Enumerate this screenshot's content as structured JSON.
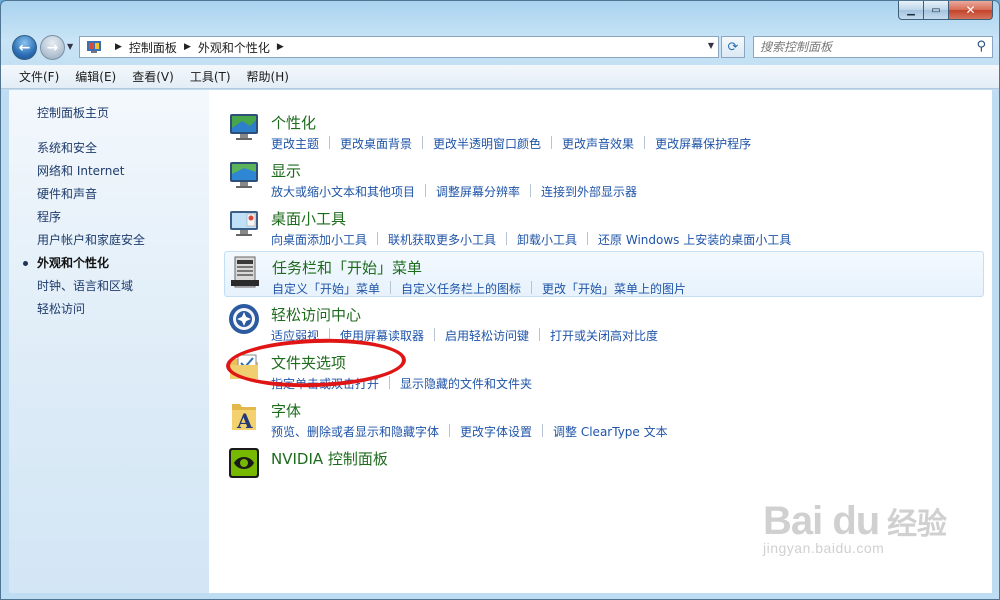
{
  "colors": {
    "link": "#1f54a8",
    "category_title": "#1d6b1d",
    "annotation": "#e01515",
    "sidebar_text": "#1e3b6c"
  },
  "window": {
    "caption_buttons": {
      "minimize_icon": "minimize-icon",
      "maximize_icon": "maximize-icon",
      "close_icon": "close-icon"
    }
  },
  "address": {
    "crumbs": [
      "控制面板",
      "外观和个性化"
    ]
  },
  "search": {
    "placeholder": "搜索控制面板"
  },
  "menu": [
    {
      "label": "文件(F)"
    },
    {
      "label": "编辑(E)"
    },
    {
      "label": "查看(V)"
    },
    {
      "label": "工具(T)"
    },
    {
      "label": "帮助(H)"
    }
  ],
  "sidebar": {
    "home": "控制面板主页",
    "items": [
      {
        "label": "系统和安全",
        "active": false
      },
      {
        "label": "网络和 Internet",
        "active": false
      },
      {
        "label": "硬件和声音",
        "active": false
      },
      {
        "label": "程序",
        "active": false
      },
      {
        "label": "用户帐户和家庭安全",
        "active": false
      },
      {
        "label": "外观和个性化",
        "active": true
      },
      {
        "label": "时钟、语言和区域",
        "active": false
      },
      {
        "label": "轻松访问",
        "active": false
      }
    ]
  },
  "categories": [
    {
      "icon": "monitor-personalize-icon",
      "title": "个性化",
      "links": [
        "更改主题",
        "更改桌面背景",
        "更改半透明窗口颜色",
        "更改声音效果",
        "更改屏幕保护程序"
      ]
    },
    {
      "icon": "display-icon",
      "title": "显示",
      "links": [
        "放大或缩小文本和其他项目",
        "调整屏幕分辨率",
        "连接到外部显示器"
      ]
    },
    {
      "icon": "desktop-gadgets-icon",
      "title": "桌面小工具",
      "links": [
        "向桌面添加小工具",
        "联机获取更多小工具",
        "卸载小工具",
        "还原 Windows 上安装的桌面小工具"
      ]
    },
    {
      "icon": "taskbar-start-menu-icon",
      "title": "任务栏和「开始」菜单",
      "links": [
        "自定义「开始」菜单",
        "自定义任务栏上的图标",
        "更改「开始」菜单上的图片"
      ]
    },
    {
      "icon": "ease-of-access-icon",
      "title": "轻松访问中心",
      "links": [
        "适应弱视",
        "使用屏幕读取器",
        "启用轻松访问键",
        "打开或关闭高对比度"
      ]
    },
    {
      "icon": "folder-options-icon",
      "title": "文件夹选项",
      "links": [
        "指定单击或双击打开",
        "显示隐藏的文件和文件夹"
      ]
    },
    {
      "icon": "fonts-icon",
      "title": "字体",
      "links": [
        "预览、删除或者显示和隐藏字体",
        "更改字体设置",
        "调整 ClearType 文本"
      ]
    },
    {
      "icon": "nvidia-icon",
      "title": "NVIDIA 控制面板",
      "links": []
    }
  ],
  "watermark": {
    "logo": "Bai du",
    "cn": "经验",
    "url": "jingyan.baidu.com"
  }
}
